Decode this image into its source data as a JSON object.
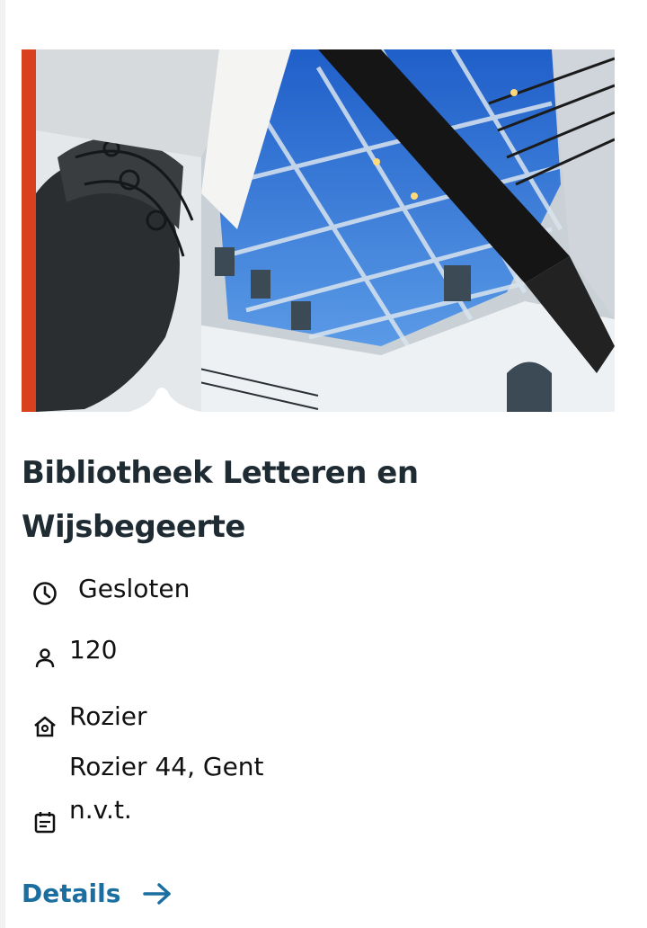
{
  "card": {
    "title": "Bibliotheek Letteren en Wijsbegeerte",
    "status": "Gesloten",
    "capacity": "120",
    "location_name": "Rozier",
    "address": "Rozier 44, Gent",
    "calendar_value": "n.v.t.",
    "details_label": "Details"
  },
  "icons": {
    "status": "clock-icon",
    "capacity": "person-icon",
    "location": "home-icon",
    "calendar": "calendar-icon",
    "details": "arrow-right-icon"
  },
  "colors": {
    "accent": "#d9411e",
    "title": "#1f2b33",
    "link": "#1a6ea0"
  }
}
